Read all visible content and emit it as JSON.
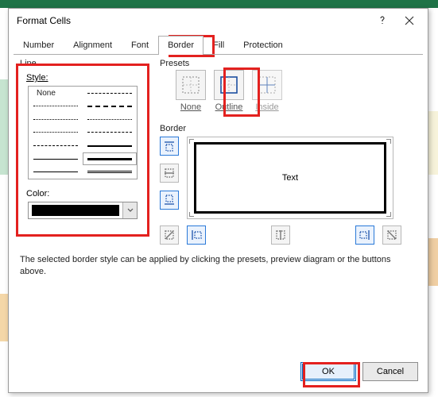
{
  "dialog": {
    "title": "Format Cells"
  },
  "tabs": {
    "number": "Number",
    "alignment": "Alignment",
    "font": "Font",
    "border": "Border",
    "fill": "Fill",
    "protection": "Protection",
    "active": "border"
  },
  "line": {
    "group": "Line",
    "style_label": "Style:",
    "none_label": "None",
    "color_label": "Color:",
    "color_value": "#000000"
  },
  "presets": {
    "group": "Presets",
    "none": "None",
    "outline": "Outline",
    "inside": "Inside"
  },
  "border": {
    "group": "Border",
    "preview_text": "Text"
  },
  "description": "The selected border style can be applied by clicking the presets, preview diagram or the buttons above.",
  "buttons": {
    "ok": "OK",
    "cancel": "Cancel"
  }
}
